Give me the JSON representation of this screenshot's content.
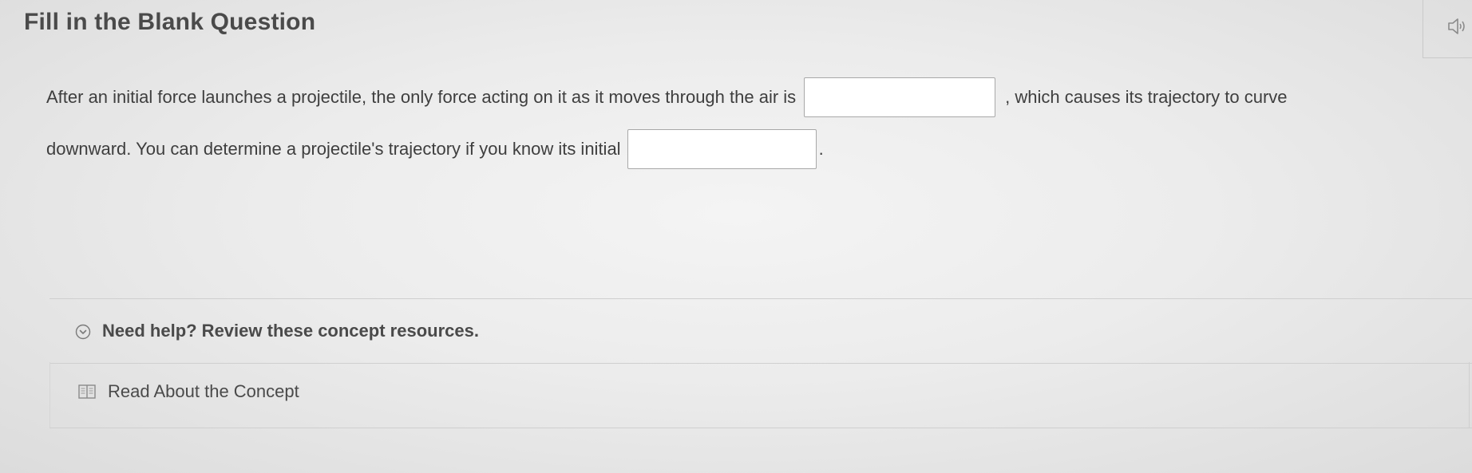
{
  "question": {
    "title": "Fill in the Blank Question",
    "line1_before": "After an initial force launches a projectile, the only force acting on it as it moves through the air is",
    "line1_after": ", which causes its trajectory to curve",
    "line2_before": "downward. You can determine a projectile's trajectory if you know its initial",
    "line2_after": ".",
    "blanks": [
      {
        "value": ""
      },
      {
        "value": ""
      }
    ]
  },
  "audio": {
    "icon": "speaker-icon"
  },
  "help": {
    "label": "Need help? Review these concept resources.",
    "icon": "chevron-down-circle-icon"
  },
  "resources": [
    {
      "label": "Read About the Concept",
      "icon": "book-icon"
    }
  ]
}
